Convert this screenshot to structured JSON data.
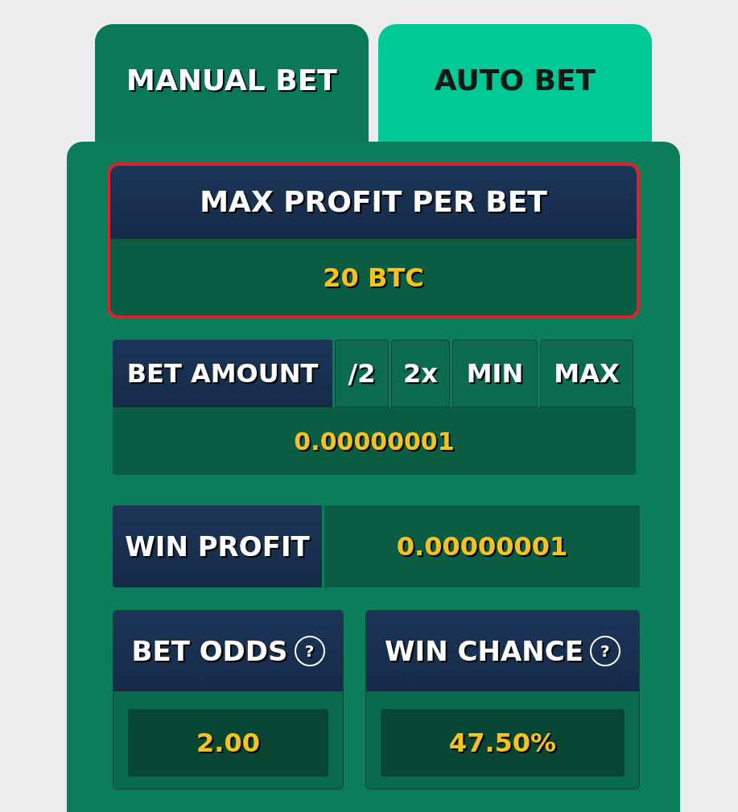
{
  "tabs": [
    {
      "label": "MANUAL BET",
      "selected": true
    },
    {
      "label": "AUTO BET",
      "selected": false
    }
  ],
  "max_profit": {
    "label": "MAX PROFIT PER BET",
    "value": "20 BTC"
  },
  "bet_amount": {
    "label": "BET AMOUNT",
    "buttons": [
      "/2",
      "2x",
      "MIN",
      "MAX"
    ],
    "value": "0.00000001"
  },
  "win_profit": {
    "label": "WIN PROFIT",
    "value": "0.00000001"
  },
  "stats": [
    {
      "label": "BET ODDS",
      "help": "?",
      "value": "2.00"
    },
    {
      "label": "WIN CHANCE",
      "help": "?",
      "value": "47.50%"
    }
  ]
}
